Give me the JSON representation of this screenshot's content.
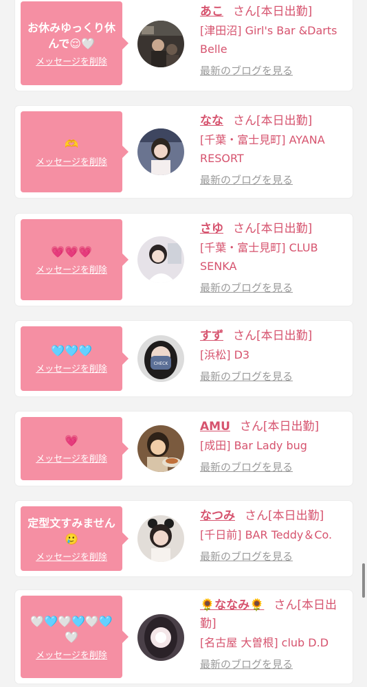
{
  "colors": {
    "accent": "#d6536e",
    "bubble": "#f58fa3",
    "muted": "#9a9a9a"
  },
  "common": {
    "san_label": "さん",
    "delete_label": "メッセージを削除",
    "blog_label": "最新のブログを見る"
  },
  "cards": [
    {
      "message": "お休みゆっくり休んで😌🤍",
      "name": "あこ",
      "status": "[本日出勤]",
      "shop": "[津田沼] Girl's Bar &Darts Belle"
    },
    {
      "message": "🫶",
      "name": "なな",
      "status": "[本日出勤]",
      "shop": "[千葉・富士見町] AYANA RESORT"
    },
    {
      "message": "💗💗💗",
      "name": "さゆ",
      "status": "[本日出勤]",
      "shop": "[千葉・富士見町] CLUB SENKA"
    },
    {
      "message": "🩵🩵🩵",
      "name": "すず",
      "status": "[本日出勤]",
      "shop": "[浜松] D3"
    },
    {
      "message": "💗",
      "name": "AMU",
      "status": "[本日出勤]",
      "shop": "[成田] Bar Lady bug"
    },
    {
      "message": "定型文すみません🥲",
      "name": "なつみ",
      "status": "[本日出勤]",
      "shop": "[千日前] BAR Teddy＆Co."
    },
    {
      "message": "🤍🩵🤍🩵🤍🩵🤍",
      "name": "🌻ななみ🌻",
      "status": "[本日出勤]",
      "shop": "[名古屋 大曽根] club D.D"
    }
  ]
}
